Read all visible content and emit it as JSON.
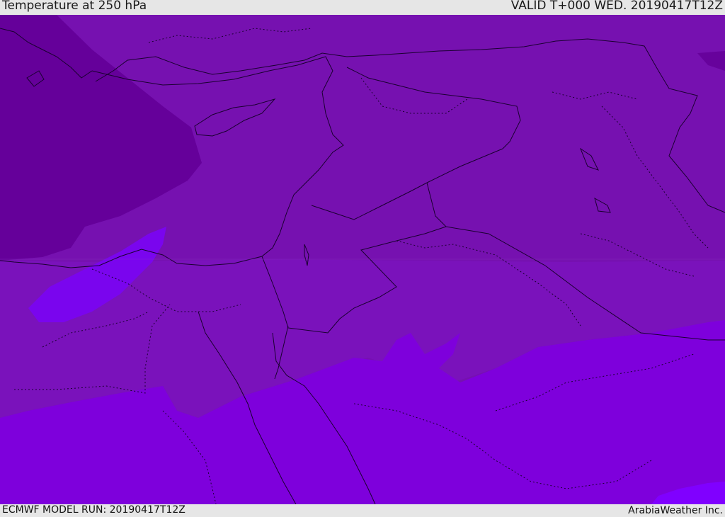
{
  "header": {
    "title": "Temperature at 250 hPa",
    "valid": "VALID T+000 WED. 20190417T12Z"
  },
  "footer": {
    "model_run": "ECMWF MODEL RUN: 20190417T12Z",
    "credit": "ArabiaWeather Inc."
  },
  "colors": {
    "cold": "#65009a",
    "mid": "#7611b0",
    "mid_south": "#7a12bb",
    "warm": "#7e00dc",
    "warmest": "#8000ff",
    "patch": "#7a05ee",
    "border": "#1a0030"
  }
}
